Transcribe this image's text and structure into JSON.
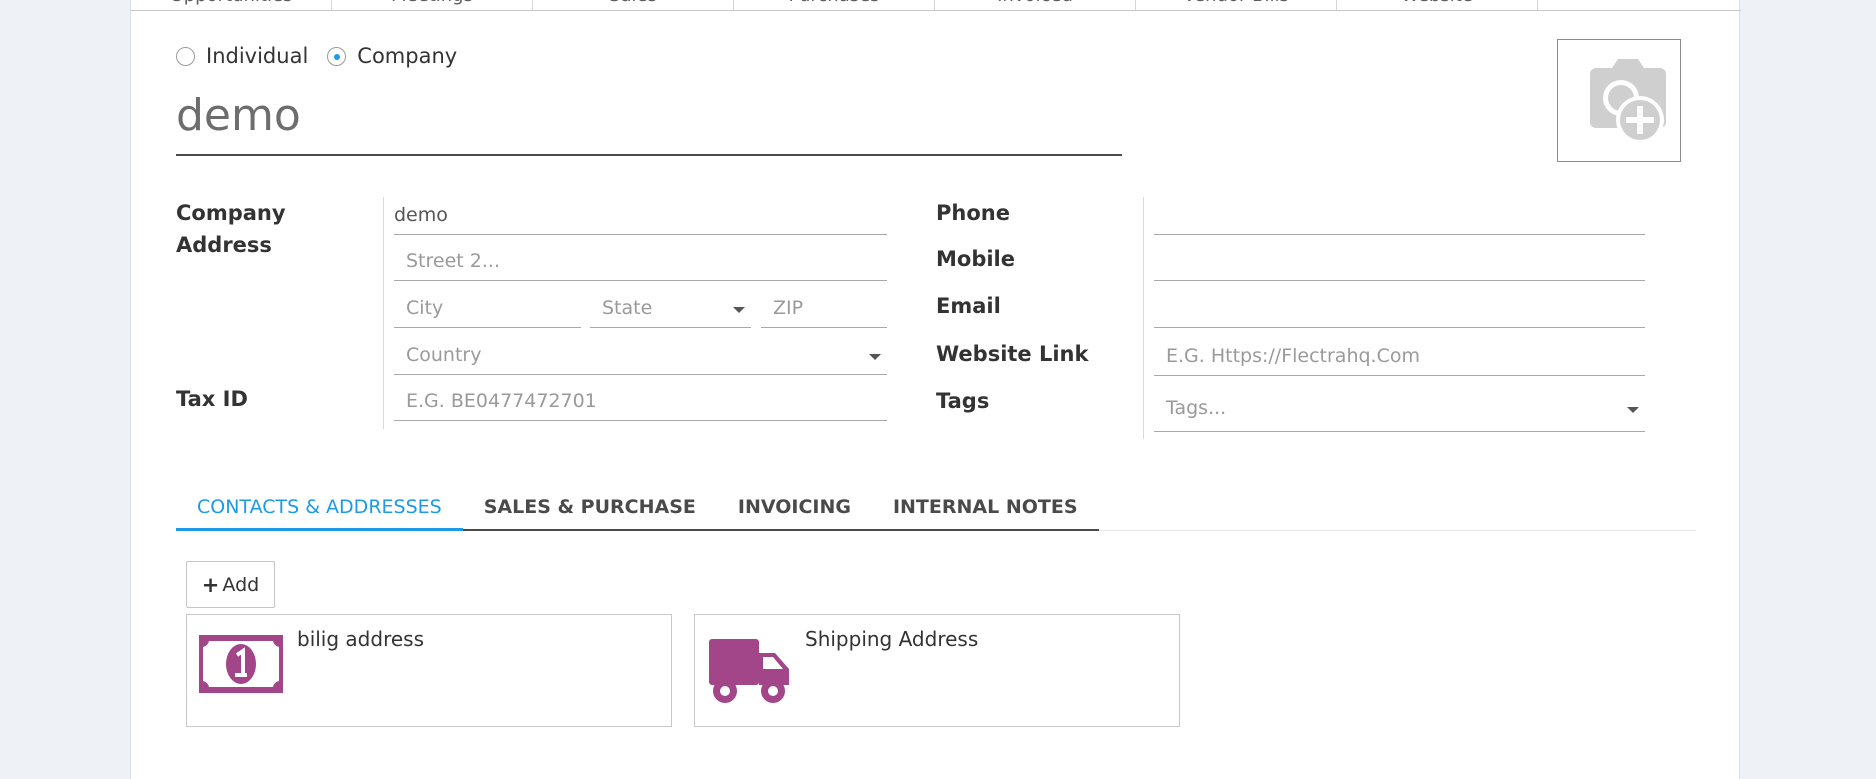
{
  "stat_buttons": [
    "Opportunities",
    "Meetings",
    "Sales",
    "Purchases",
    "Invoiced",
    "Vendor Bills",
    "Website"
  ],
  "company_type": {
    "options": [
      {
        "label": "Individual",
        "checked": false
      },
      {
        "label": "Company",
        "checked": true
      }
    ]
  },
  "name": "demo",
  "photo": {
    "icon": "camera-plus-icon"
  },
  "left_form": {
    "address_label": "Company Address",
    "street": "demo",
    "street2_placeholder": "Street 2...",
    "city_placeholder": "City",
    "state_placeholder": "State",
    "zip_placeholder": "ZIP",
    "country_placeholder": "Country",
    "tax_label": "Tax ID",
    "tax_placeholder": "E.G. BE0477472701"
  },
  "right_form": {
    "phone_label": "Phone",
    "phone_value": "",
    "mobile_label": "Mobile",
    "mobile_value": "",
    "email_label": "Email",
    "email_value": "",
    "website_label": "Website Link",
    "website_placeholder": "E.G. Https://Flectrahq.Com",
    "tags_label": "Tags",
    "tags_placeholder": "Tags..."
  },
  "tabs": [
    {
      "label": "CONTACTS & ADDRESSES",
      "active": true
    },
    {
      "label": "SALES & PURCHASE",
      "active": false
    },
    {
      "label": "INVOICING",
      "active": false
    },
    {
      "label": "INTERNAL NOTES",
      "active": false
    }
  ],
  "add_button": {
    "label": "Add",
    "icon": "plus-icon"
  },
  "contacts": [
    {
      "title": "bilig address",
      "icon": "money-bill-icon"
    },
    {
      "title": "Shipping Address",
      "icon": "truck-icon"
    }
  ],
  "colors": {
    "accent": "#1c9ae9",
    "card_icon": "#a24689"
  }
}
